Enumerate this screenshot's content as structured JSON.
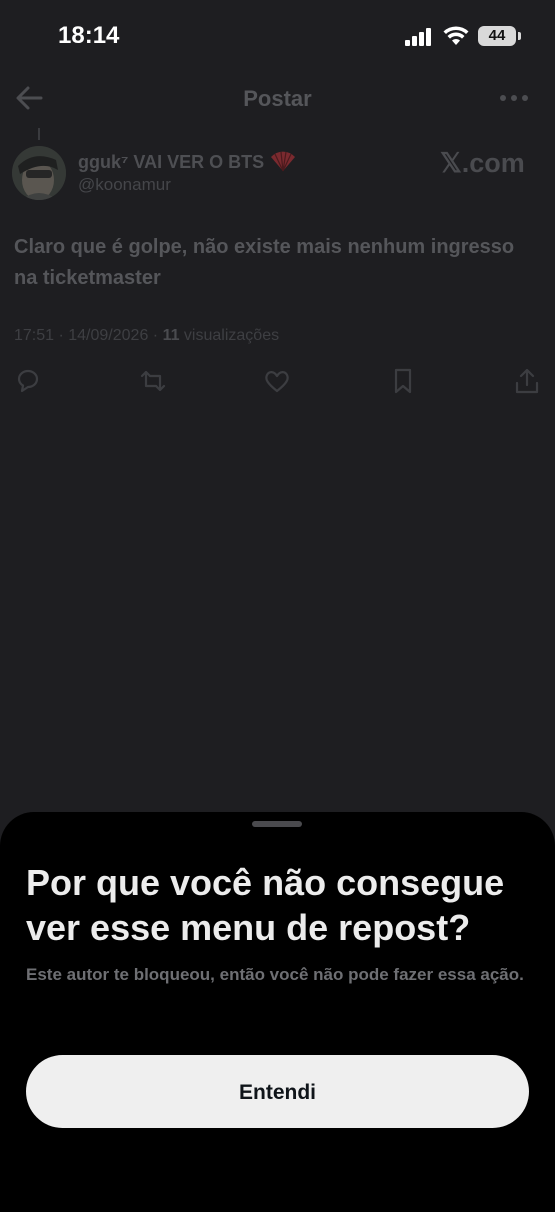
{
  "status_bar": {
    "time": "18:14",
    "battery": "44"
  },
  "header": {
    "title": "Postar",
    "back_icon": "arrow-left-icon",
    "more_icon": "more-horizontal-icon"
  },
  "post": {
    "author_name": "gguk⁷ VAI VER O BTS",
    "handle": "@koonamur",
    "source_brand": "𝕏.com",
    "text": "Claro que é golpe, não existe mais nenhum ingresso na ticketmaster",
    "time_date": "17:51 · 14/09/2026 · ",
    "views_count": "11",
    "views_label": " visualizações",
    "action_icons": [
      "reply-icon",
      "repost-icon",
      "like-icon",
      "bookmark-icon",
      "share-icon"
    ]
  },
  "sheet": {
    "title": "Por que você não consegue ver esse menu de repost?",
    "description": "Este autor te bloqueou, então você não pode fazer essa ação.",
    "button_label": "Entendi"
  },
  "colors": {
    "background": "#1e1e21",
    "sheet": "#000000",
    "button": "#efefef",
    "button_text": "#0f1419"
  }
}
